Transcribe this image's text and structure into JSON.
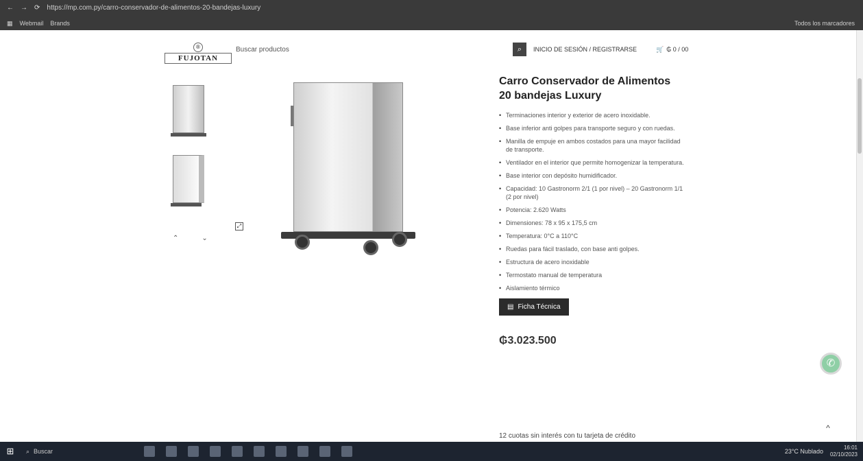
{
  "browser": {
    "url": "https://mp.com.py/carro-conservador-de-alimentos-20-bandejas-luxury",
    "bookmarks": [
      "Webmail",
      "Brands"
    ],
    "sidebar_label": "Todos los marcadores"
  },
  "header": {
    "logo_text": "FUJOTAN",
    "search_placeholder": "Buscar productos",
    "login_label": "INICIO DE SESIÓN / REGISTRARSE",
    "cart_total": "₲ 0 / 00"
  },
  "product": {
    "title": "Carro Conservador de Alimentos 20 bandejas Luxury",
    "features": [
      "Terminaciones interior y exterior de acero inoxidable.",
      "Base inferior anti golpes para transporte seguro y con ruedas.",
      "Manilla de empuje en ambos costados para una mayor facilidad de transporte.",
      "Ventilador en el interior que permite homogenizar la temperatura.",
      "Base interior con depósito humidificador.",
      "Capacidad: 10 Gastronorm 2/1 (1 por nivel) – 20 Gastronorm 1/1 (2 por nivel)",
      "Potencia: 2.620 Watts",
      "Dimensiones: 78 x 95 x 175,5 cm",
      "Temperatura: 0°C a 110°C",
      "Ruedas para fácil traslado, con base anti golpes.",
      "Estructura de acero inoxidable",
      "Termostato manual de temperatura",
      "Aislamiento térmico"
    ],
    "ficha_label": "Ficha Técnica",
    "price": "₲3.023.500",
    "installments": "12 cuotas sin interés con tu tarjeta de crédito"
  },
  "taskbar": {
    "search_label": "Buscar",
    "weather": "23°C Nublado",
    "time": "16:01",
    "date": "02/10/2023"
  },
  "icons": [
    "search-icon",
    "cart-icon",
    "whatsapp-icon",
    "chevron-up-icon",
    "zoom-icon",
    "file-icon"
  ],
  "colors": {
    "button_dark": "#2b2b2b",
    "whatsapp": "#8fcfa6"
  }
}
